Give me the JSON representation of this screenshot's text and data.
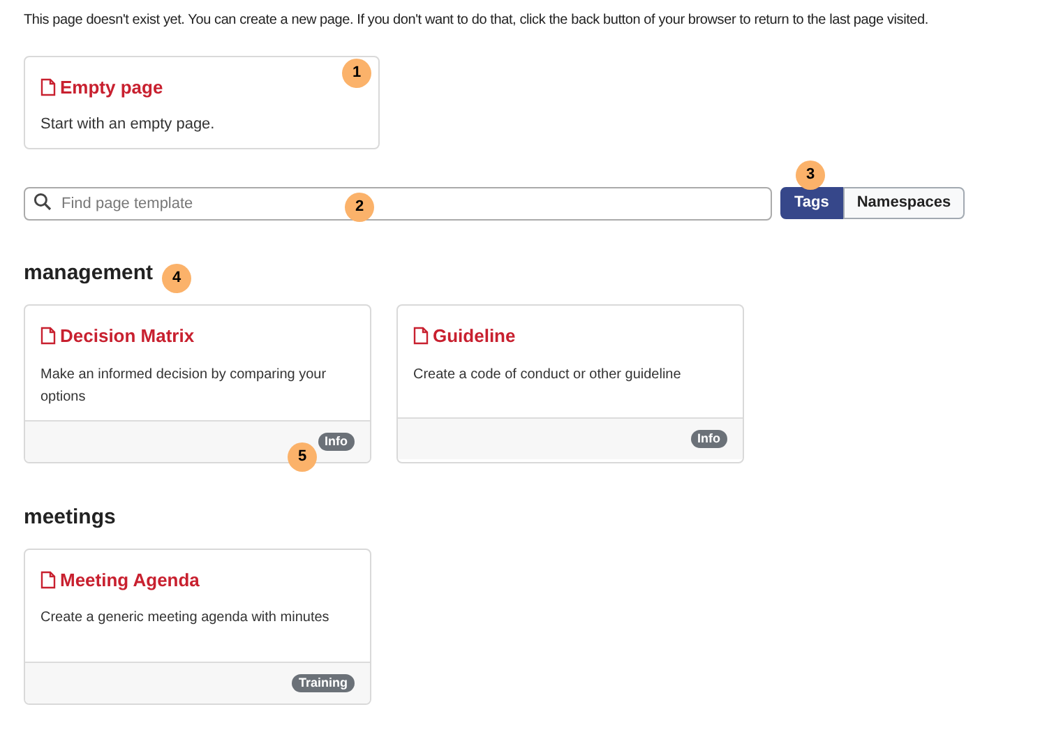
{
  "intro": "This page doesn't exist yet. You can create a new page. If you don't want to do that, click the back button of your browser to return to the last page visited.",
  "empty_card": {
    "title": "Empty page",
    "description": "Start with an empty page."
  },
  "search": {
    "placeholder": "Find page template"
  },
  "view_toggle": [
    {
      "label": "Tags",
      "selected": true
    },
    {
      "label": "Namespaces",
      "selected": false
    }
  ],
  "groups": [
    {
      "heading": "management",
      "templates": [
        {
          "title": "Decision Matrix",
          "description": "Make an informed decision by comparing your options",
          "tag": "Info"
        },
        {
          "title": "Guideline",
          "description": "Create a code of conduct or other guideline",
          "tag": "Info"
        }
      ]
    },
    {
      "heading": "meetings",
      "templates": [
        {
          "title": "Meeting Agenda",
          "description": "Create a generic meeting agenda with minutes",
          "tag": "Training"
        }
      ]
    }
  ],
  "callouts": [
    {
      "label": "1"
    },
    {
      "label": "2"
    },
    {
      "label": "3"
    },
    {
      "label": "4"
    },
    {
      "label": "5"
    }
  ]
}
